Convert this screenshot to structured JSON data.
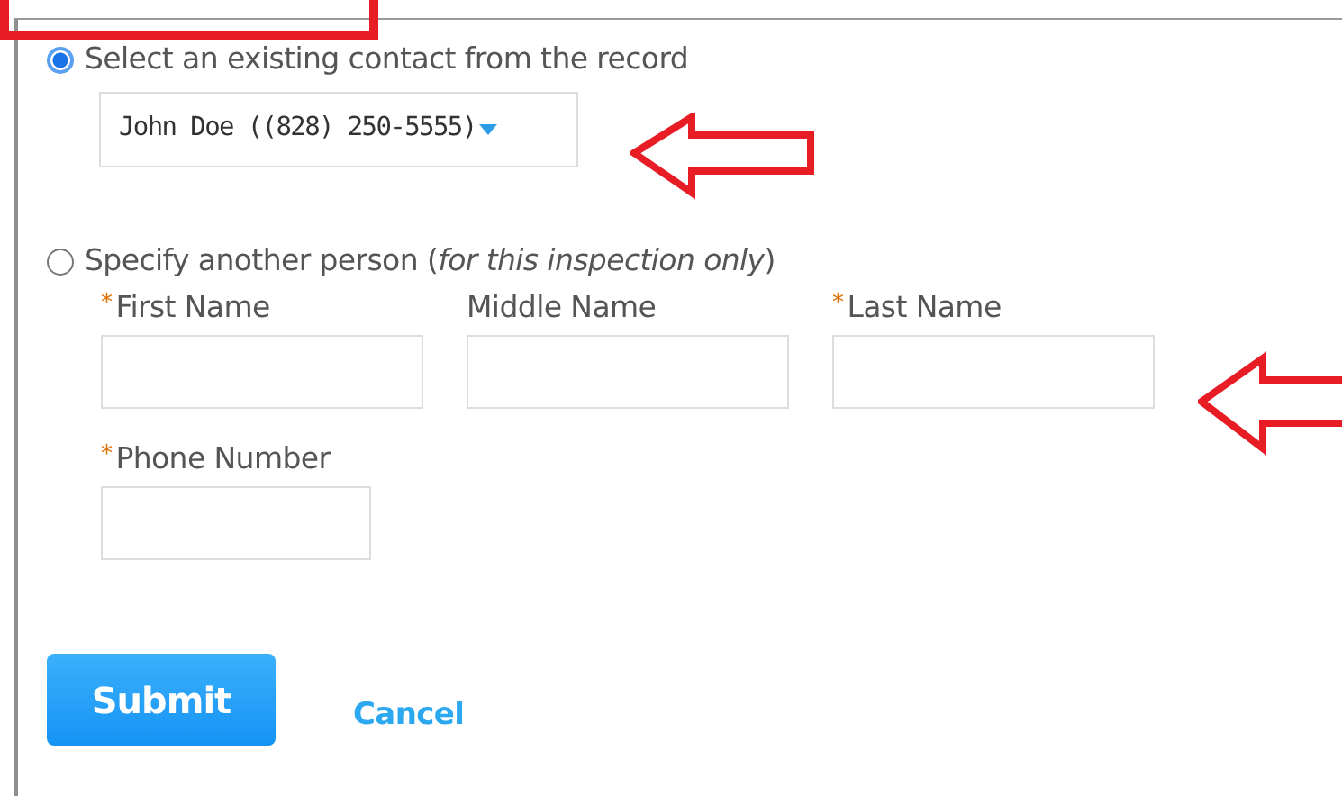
{
  "contact_options": [
    {
      "label": "Select an existing contact from the record",
      "selected": true,
      "kind": "select",
      "value": "John Doe ((828) 250-5555)"
    },
    {
      "label": "Specify another person (*for this inspection only*)",
      "selected": false,
      "kind": "person"
    }
  ],
  "person_fields": [
    {
      "label": "First Name",
      "required": true
    },
    {
      "label": "Middle Name",
      "required": false
    },
    {
      "label": "Last Name",
      "required": true
    },
    {
      "label": "Phone Number",
      "required": true
    }
  ],
  "required_mark": "*",
  "buttons": {
    "submit": "Submit",
    "cancel": "Cancel"
  }
}
